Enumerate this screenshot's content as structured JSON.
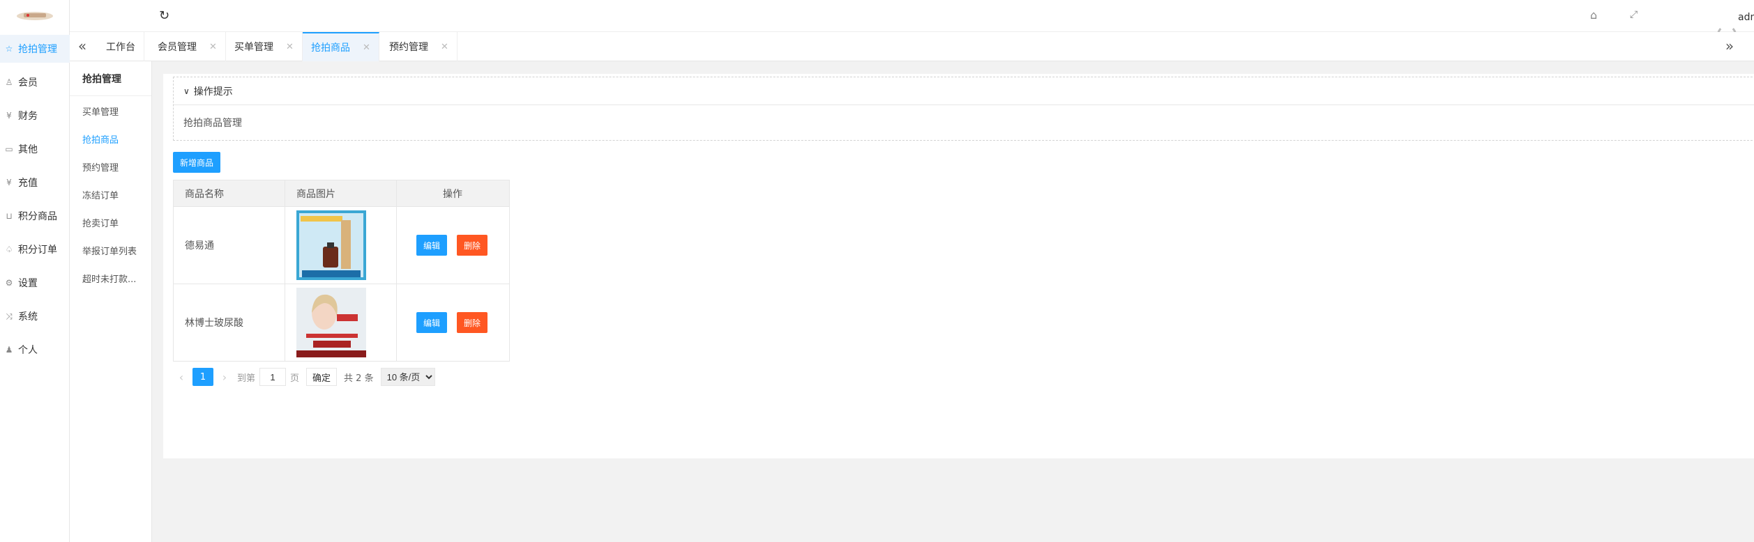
{
  "nav": {
    "items": [
      {
        "label": "抢拍管理",
        "icon": "star-icon",
        "glyph": "☆",
        "active": true
      },
      {
        "label": "会员",
        "icon": "user-icon",
        "glyph": "♙"
      },
      {
        "label": "财务",
        "icon": "yen-icon",
        "glyph": "¥"
      },
      {
        "label": "其他",
        "icon": "book-icon",
        "glyph": "▭"
      },
      {
        "label": "充值",
        "icon": "yen-circle-icon",
        "glyph": "¥"
      },
      {
        "label": "积分商品",
        "icon": "cart-icon",
        "glyph": "⊔"
      },
      {
        "label": "积分订单",
        "icon": "bell-icon",
        "glyph": "♤"
      },
      {
        "label": "设置",
        "icon": "gear-icon",
        "glyph": "⚙"
      },
      {
        "label": "系统",
        "icon": "shuffle-icon",
        "glyph": "⤨"
      },
      {
        "label": "个人",
        "icon": "person-icon",
        "glyph": "♟"
      }
    ]
  },
  "topbar": {
    "user": "admin（系统管理员"
  },
  "tabs": [
    {
      "label": "工作台",
      "closable": false
    },
    {
      "label": "会员管理",
      "closable": true
    },
    {
      "label": "买单管理",
      "closable": true
    },
    {
      "label": "抢拍商品",
      "closable": true,
      "active": true
    },
    {
      "label": "预约管理",
      "closable": true
    }
  ],
  "submenu": {
    "title": "抢拍管理",
    "items": [
      {
        "label": "买单管理"
      },
      {
        "label": "抢拍商品",
        "active": true
      },
      {
        "label": "预约管理"
      },
      {
        "label": "冻结订单"
      },
      {
        "label": "抢卖订单"
      },
      {
        "label": "举报订单列表"
      },
      {
        "label": "超时未打款..."
      }
    ]
  },
  "tips": {
    "title": "操作提示",
    "body": "抢拍商品管理"
  },
  "toolbar": {
    "add_label": "新增商品"
  },
  "table": {
    "headers": [
      "商品名称",
      "商品图片",
      "操作"
    ],
    "rows": [
      {
        "name": "德易通",
        "edit": "编辑",
        "delete": "删除"
      },
      {
        "name": "林博士玻尿酸",
        "edit": "编辑",
        "delete": "删除"
      }
    ]
  },
  "pager": {
    "current": "1",
    "goto_label": "到第",
    "page_value": "1",
    "page_suffix": "页",
    "confirm": "确定",
    "total": "共 2 条",
    "page_size": "10 条/页"
  },
  "colors": {
    "primary": "#1e9fff",
    "danger": "#ff5722",
    "bg": "#f2f2f2"
  }
}
